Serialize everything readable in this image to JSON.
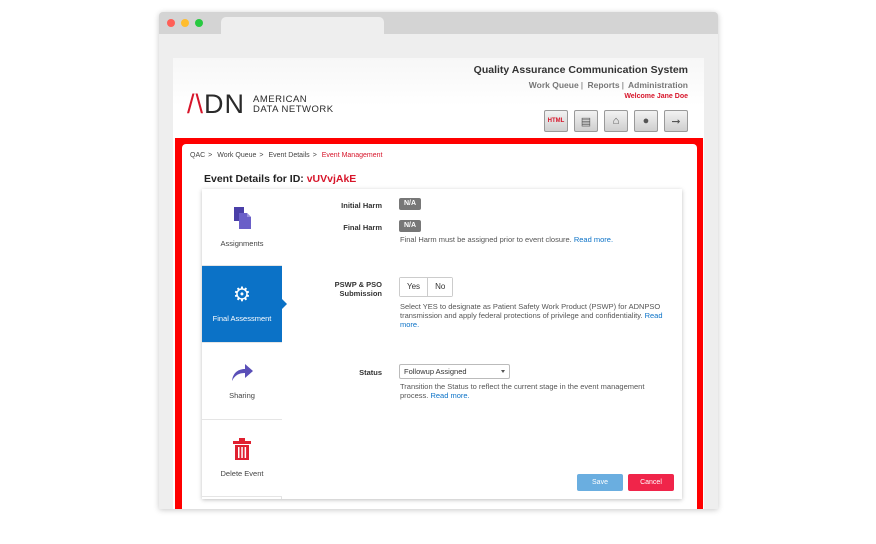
{
  "header": {
    "system_title": "Quality Assurance Communication System",
    "nav": [
      "Work Queue",
      "Reports",
      "Administration"
    ],
    "separator": "|",
    "welcome": "Welcome Jane Doe",
    "logo_mark_a": "/\\",
    "logo_mark_b": "DN",
    "logo_line1": "AMERICAN",
    "logo_line2": "DATA NETWORK",
    "tool_icons": [
      "html-icon",
      "document-icon",
      "home-icon",
      "user-icon",
      "logout-icon"
    ],
    "tool_html_text": "HTML"
  },
  "breadcrumb": {
    "items": [
      "QAC",
      "Work Queue",
      "Event Details"
    ],
    "current": "Event Management",
    "sep": ">"
  },
  "event": {
    "title_prefix": "Event Details for ID:",
    "id": "vUVvjAkE"
  },
  "sidebar": {
    "items": [
      {
        "label": "Assignments",
        "icon": "documents-icon",
        "active": false
      },
      {
        "label": "Final Assessment",
        "icon": "gears-icon",
        "active": true
      },
      {
        "label": "Sharing",
        "icon": "share-arrow-icon",
        "active": false
      },
      {
        "label": "Delete Event",
        "icon": "trash-icon",
        "active": false
      }
    ]
  },
  "form": {
    "initial_harm": {
      "label": "Initial Harm",
      "value": "N/A"
    },
    "final_harm": {
      "label": "Final Harm",
      "value": "N/A",
      "help": "Final Harm must be assigned prior to event closure.",
      "more": "Read more."
    },
    "pswp": {
      "label_line1": "PSWP & PSO",
      "label_line2": "Submission",
      "yes": "Yes",
      "no": "No",
      "help": "Select YES to designate as Patient Safety Work Product (PSWP) for ADNPSO transmission and apply federal protections of privilege and confidentiality.",
      "more": "Read more."
    },
    "status": {
      "label": "Status",
      "value": "Followup Assigned",
      "help": "Transition the Status to reflect the current stage in the event management process.",
      "more": "Read more."
    },
    "save": "Save",
    "cancel": "Cancel"
  },
  "colors": {
    "accent": "#0b72c7",
    "brand_red": "#d7152a",
    "frame_red": "#ff0000",
    "cancel": "#f0254a",
    "save": "#6aaee0"
  }
}
